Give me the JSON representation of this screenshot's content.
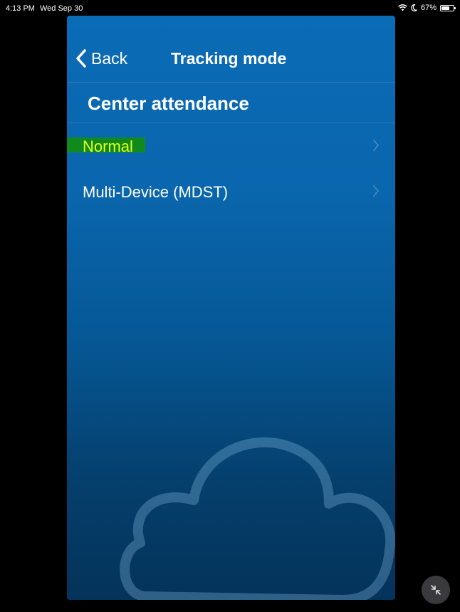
{
  "status_bar": {
    "time": "4:13 PM",
    "date": "Wed Sep 30",
    "battery": "67%",
    "battery_level": 0.67
  },
  "nav": {
    "back_label": "Back",
    "title": "Tracking mode"
  },
  "section": {
    "title": "Center attendance"
  },
  "rows": [
    {
      "label": "Normal",
      "highlighted": true
    },
    {
      "label": "Multi-Device (MDST)",
      "highlighted": false
    }
  ],
  "colors": {
    "accent": "#0a6bb6",
    "highlight_bg": "#108a1c",
    "highlight_text": "#e4ff1a"
  },
  "icons": [
    "wifi-icon",
    "moon-icon",
    "battery-icon",
    "chevron-left-icon",
    "chevron-right-icon",
    "cloud-icon",
    "minimize-icon"
  ]
}
